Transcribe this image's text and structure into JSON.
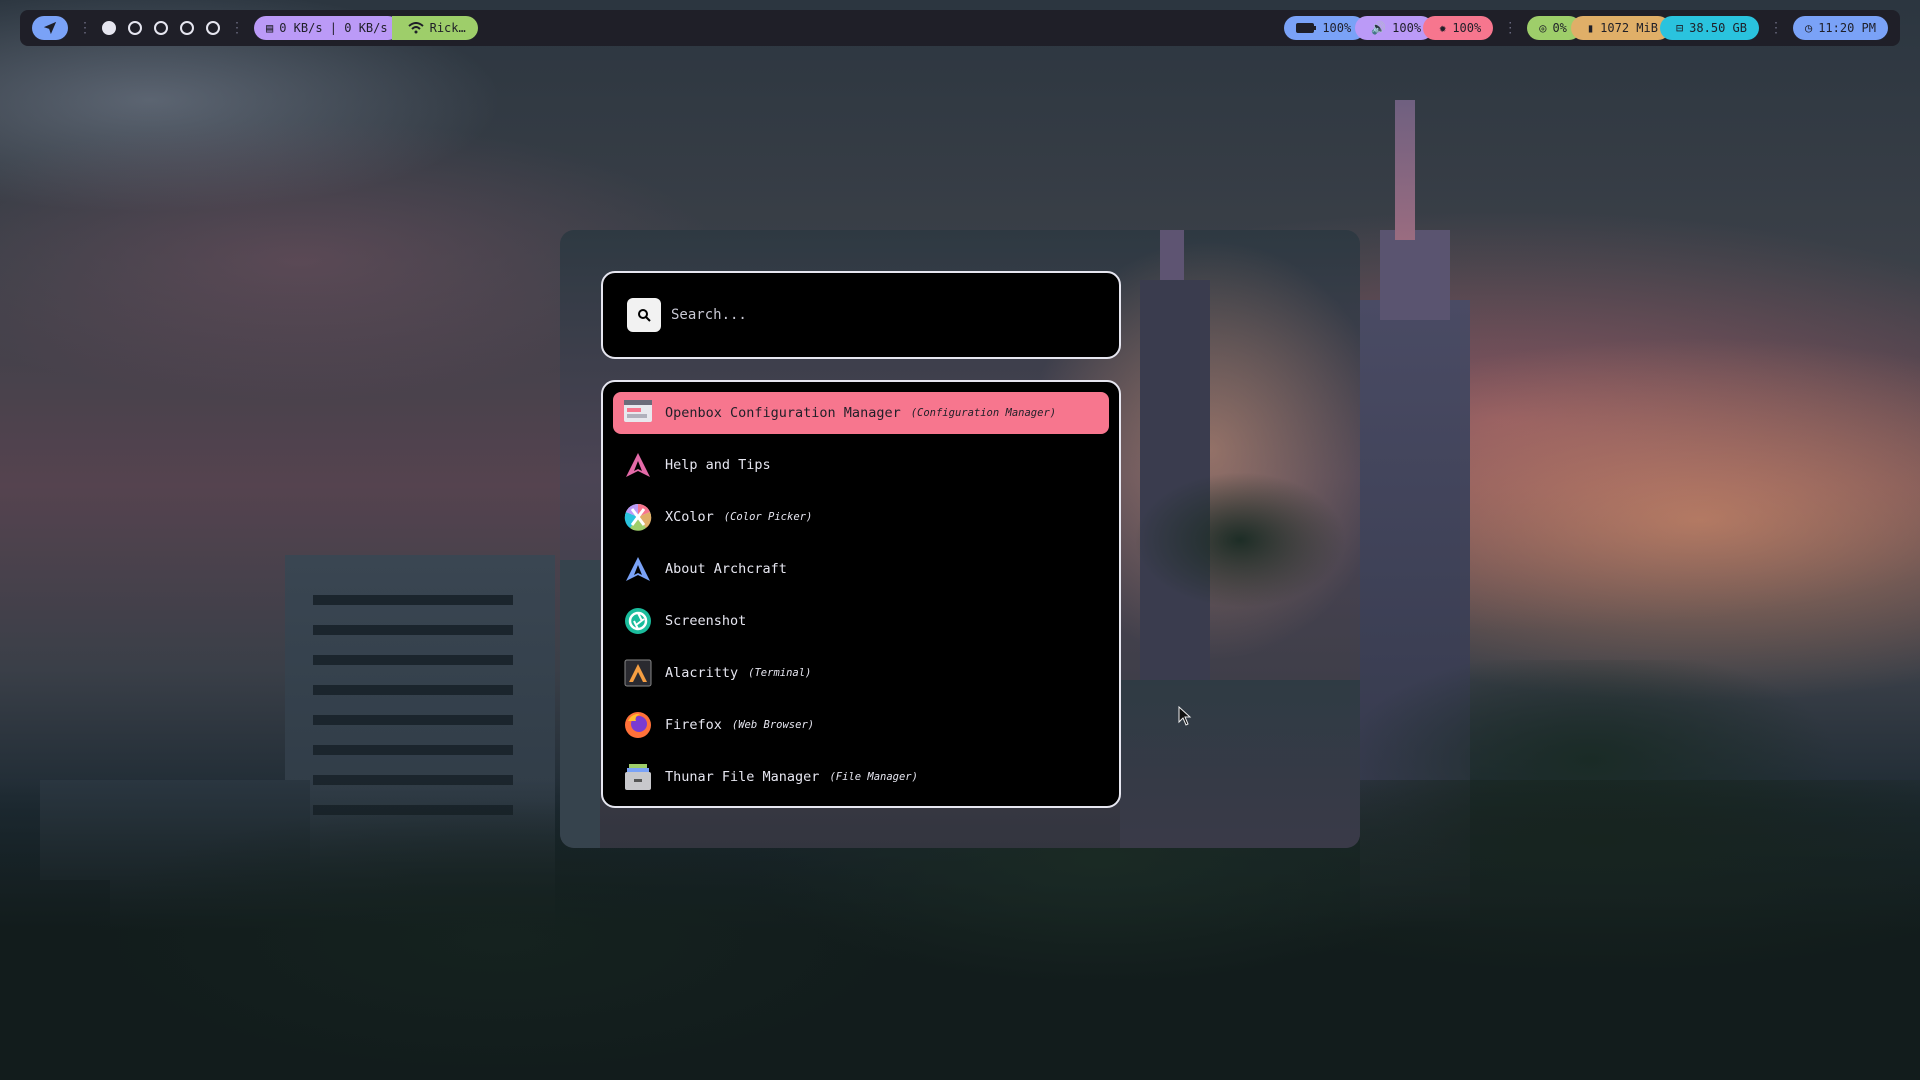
{
  "topbar": {
    "network": "0 KB/s | 0 KB/s",
    "wifi": "Rick…",
    "battery": "100%",
    "volume": "100%",
    "brightness": "100%",
    "cpu": "0%",
    "memory": "1072 MiB",
    "disk": "38.50 GB",
    "clock": "11:20 PM",
    "workspaces": [
      true,
      false,
      false,
      false,
      false
    ],
    "colors": {
      "blue": "#7aa2f7",
      "purple": "#bb9af7",
      "green": "#9ece6a",
      "red": "#f7768e",
      "yellow": "#e0af68",
      "cyan": "#2ac3de",
      "bar_bg": "#1f1f28"
    }
  },
  "launcher": {
    "search_placeholder": "Search...",
    "items": [
      {
        "name": "Openbox Configuration Manager",
        "desc": "(Configuration Manager)",
        "icon": "window-config-icon",
        "selected": true
      },
      {
        "name": "Help and Tips",
        "desc": "",
        "icon": "archcraft-help-icon",
        "selected": false
      },
      {
        "name": "XColor",
        "desc": "(Color Picker)",
        "icon": "color-picker-icon",
        "selected": false
      },
      {
        "name": "About Archcraft",
        "desc": "",
        "icon": "archcraft-icon",
        "selected": false
      },
      {
        "name": "Screenshot",
        "desc": "",
        "icon": "camera-shutter-icon",
        "selected": false
      },
      {
        "name": "Alacritty",
        "desc": "(Terminal)",
        "icon": "terminal-icon",
        "selected": false
      },
      {
        "name": "Firefox",
        "desc": "(Web Browser)",
        "icon": "firefox-icon",
        "selected": false
      },
      {
        "name": "Thunar File Manager",
        "desc": "(File Manager)",
        "icon": "file-cabinet-icon",
        "selected": false
      }
    ],
    "selected_color": "#f7768e"
  }
}
